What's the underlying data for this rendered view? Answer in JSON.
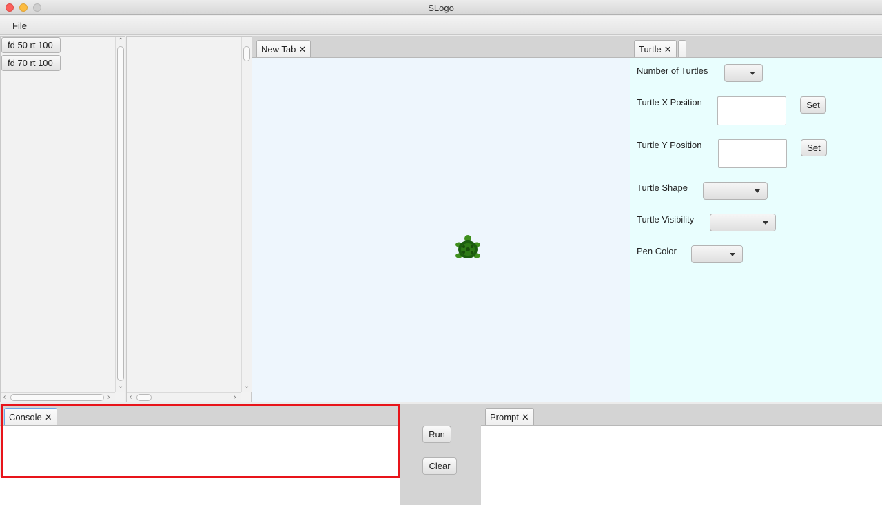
{
  "window": {
    "title": "SLogo"
  },
  "menu": {
    "file": "File"
  },
  "history": {
    "items": [
      "fd 50 rt 100",
      "fd 70 rt 100"
    ]
  },
  "canvas": {
    "tab_label": "New Tab",
    "background": "#eef6fd"
  },
  "turtle_panel": {
    "tab_label": "Turtle",
    "background": "#e9fefe",
    "number_label": "Number of Turtles",
    "x_label": "Turtle X Position",
    "y_label": "Turtle Y Position",
    "set_label": "Set",
    "shape_label": "Turtle Shape",
    "visibility_label": "Turtle Visibility",
    "pen_label": "Pen Color"
  },
  "console": {
    "tab_label": "Console",
    "highlight": "#e8141a"
  },
  "controls": {
    "run": "Run",
    "clear": "Clear"
  },
  "prompt": {
    "tab_label": "Prompt"
  },
  "close_glyph": "✕"
}
